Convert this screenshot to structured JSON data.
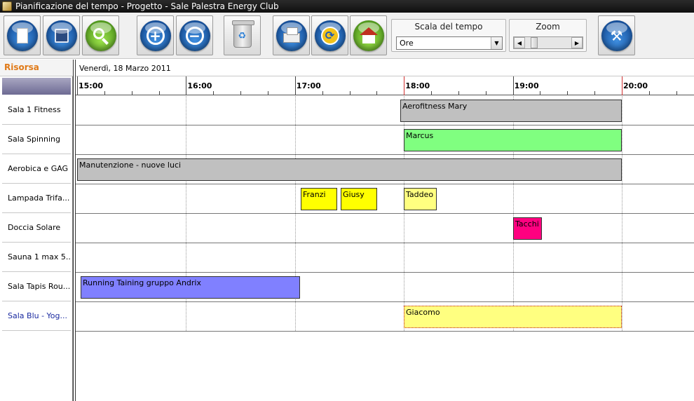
{
  "window": {
    "title": "Pianificazione del tempo  - Progetto - Sale Palestra Energy Club"
  },
  "toolbar": {
    "buttons": [
      {
        "icon": "new-document-icon"
      },
      {
        "icon": "save-disk-icon"
      },
      {
        "icon": "search-magnifier-icon"
      },
      {
        "icon": "zoom-in-plus-icon",
        "glyph": "+"
      },
      {
        "icon": "zoom-out-minus-icon",
        "glyph": "−"
      },
      {
        "icon": "recycle-bin-icon",
        "glyph": "♻"
      },
      {
        "icon": "printer-icon"
      },
      {
        "icon": "refresh-arrow-icon",
        "glyph": "⟳"
      },
      {
        "icon": "home-icon"
      },
      {
        "icon": "tools-settings-icon",
        "glyph": "⚒"
      }
    ],
    "scale": {
      "label": "Scala del tempo",
      "value": "Ore",
      "arrow": "▼"
    },
    "zoom": {
      "label": "Zoom",
      "left": "◀",
      "right": "▶",
      "level": 0.15
    }
  },
  "resources": {
    "header": "Risorsa",
    "items": [
      "Sala 1 Fitness",
      "Sala Spinning",
      "Aerobica e GAG",
      "Lampada Trifa...",
      "Doccia Solare",
      "Sauna 1 max 5...",
      "Sala Tapis Rou...",
      "Sala Blu - Yog..."
    ]
  },
  "timeline": {
    "date": "Venerdì, 18 Marzo 2011",
    "hours": [
      "15:00",
      "16:00",
      "17:00",
      "18:00",
      "19:00",
      "20:00"
    ],
    "events": [
      {
        "row": 0,
        "label": "Aerofitness Mary",
        "start": "17:58",
        "end": "20:00",
        "color": "#c0c0c0"
      },
      {
        "row": 1,
        "label": "Marcus",
        "start": "18:00",
        "end": "20:00",
        "color": "#80ff80"
      },
      {
        "row": 2,
        "label": "Manutenzione - nuove luci",
        "start": "15:00",
        "end": "20:00",
        "color": "#c0c0c0"
      },
      {
        "row": 3,
        "label": "Franzi",
        "start": "17:03",
        "end": "17:23",
        "color": "#ffff00"
      },
      {
        "row": 3,
        "label": "Giusy",
        "start": "17:25",
        "end": "17:45",
        "color": "#ffff00"
      },
      {
        "row": 3,
        "label": "Taddeo",
        "start": "18:00",
        "end": "18:18",
        "color": "#ffff80"
      },
      {
        "row": 4,
        "label": "Tacchi",
        "start": "19:00",
        "end": "19:16",
        "color": "#ff0080"
      },
      {
        "row": 6,
        "label": "Running Taining gruppo Andrix",
        "start": "15:02",
        "end": "17:03",
        "color": "#8080ff"
      },
      {
        "row": 7,
        "label": "Giacomo",
        "start": "18:00",
        "end": "20:00",
        "color": "#ffff80",
        "selected": true
      }
    ]
  }
}
